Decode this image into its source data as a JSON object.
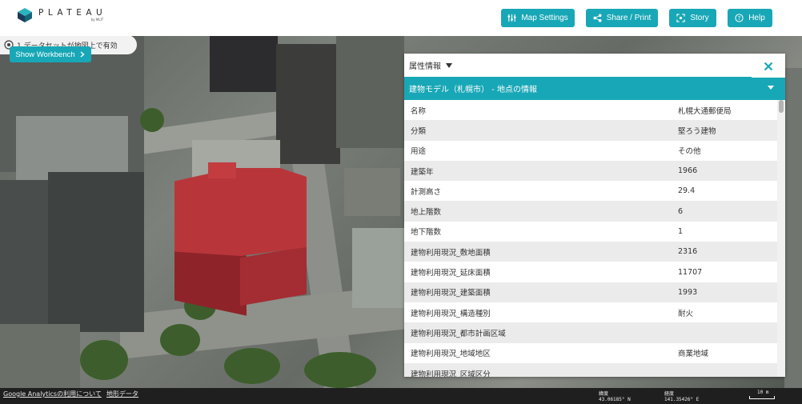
{
  "header": {
    "logo_text": "PLATEAU",
    "logo_sub": "by MLIT",
    "buttons": {
      "map_settings": "Map Settings",
      "share_print": "Share / Print",
      "story": "Story",
      "help": "Help"
    }
  },
  "overlay": {
    "dataset_notice": "1 データセットが地図上で有効",
    "workbench_label": "Show Workbench"
  },
  "panel": {
    "title": "属性情報",
    "section_title": "建物モデル（札幌市） - 地点の情報",
    "rows": [
      {
        "key": "名称",
        "value": "札幌大通郵便局"
      },
      {
        "key": "分類",
        "value": "堅ろう建物"
      },
      {
        "key": "用途",
        "value": "その他"
      },
      {
        "key": "建築年",
        "value": "1966"
      },
      {
        "key": "計測高さ",
        "value": "29.4"
      },
      {
        "key": "地上階数",
        "value": "6"
      },
      {
        "key": "地下階数",
        "value": "1"
      },
      {
        "key": "建物利用現況_敷地面積",
        "value": "2316"
      },
      {
        "key": "建物利用現況_延床面積",
        "value": "11707"
      },
      {
        "key": "建物利用現況_建築面積",
        "value": "1993"
      },
      {
        "key": "建物利用現況_構造種別",
        "value": "耐火"
      },
      {
        "key": "建物利用現況_都市計画区域",
        "value": ""
      },
      {
        "key": "建物利用現況_地域地区",
        "value": "商業地域"
      },
      {
        "key": "建物利用現況_区域区分",
        "value": ""
      }
    ]
  },
  "footer": {
    "analytics_link": "Google Analyticsの利用について",
    "terrain_link": "地形データ",
    "lat_label": "緯度",
    "lat_value": "43.06185° N",
    "lon_label": "経度",
    "lon_value": "141.35426° E",
    "scale_label": "10 m"
  },
  "colors": {
    "accent": "#18a7b6",
    "highlight_building": "#b8363a"
  }
}
